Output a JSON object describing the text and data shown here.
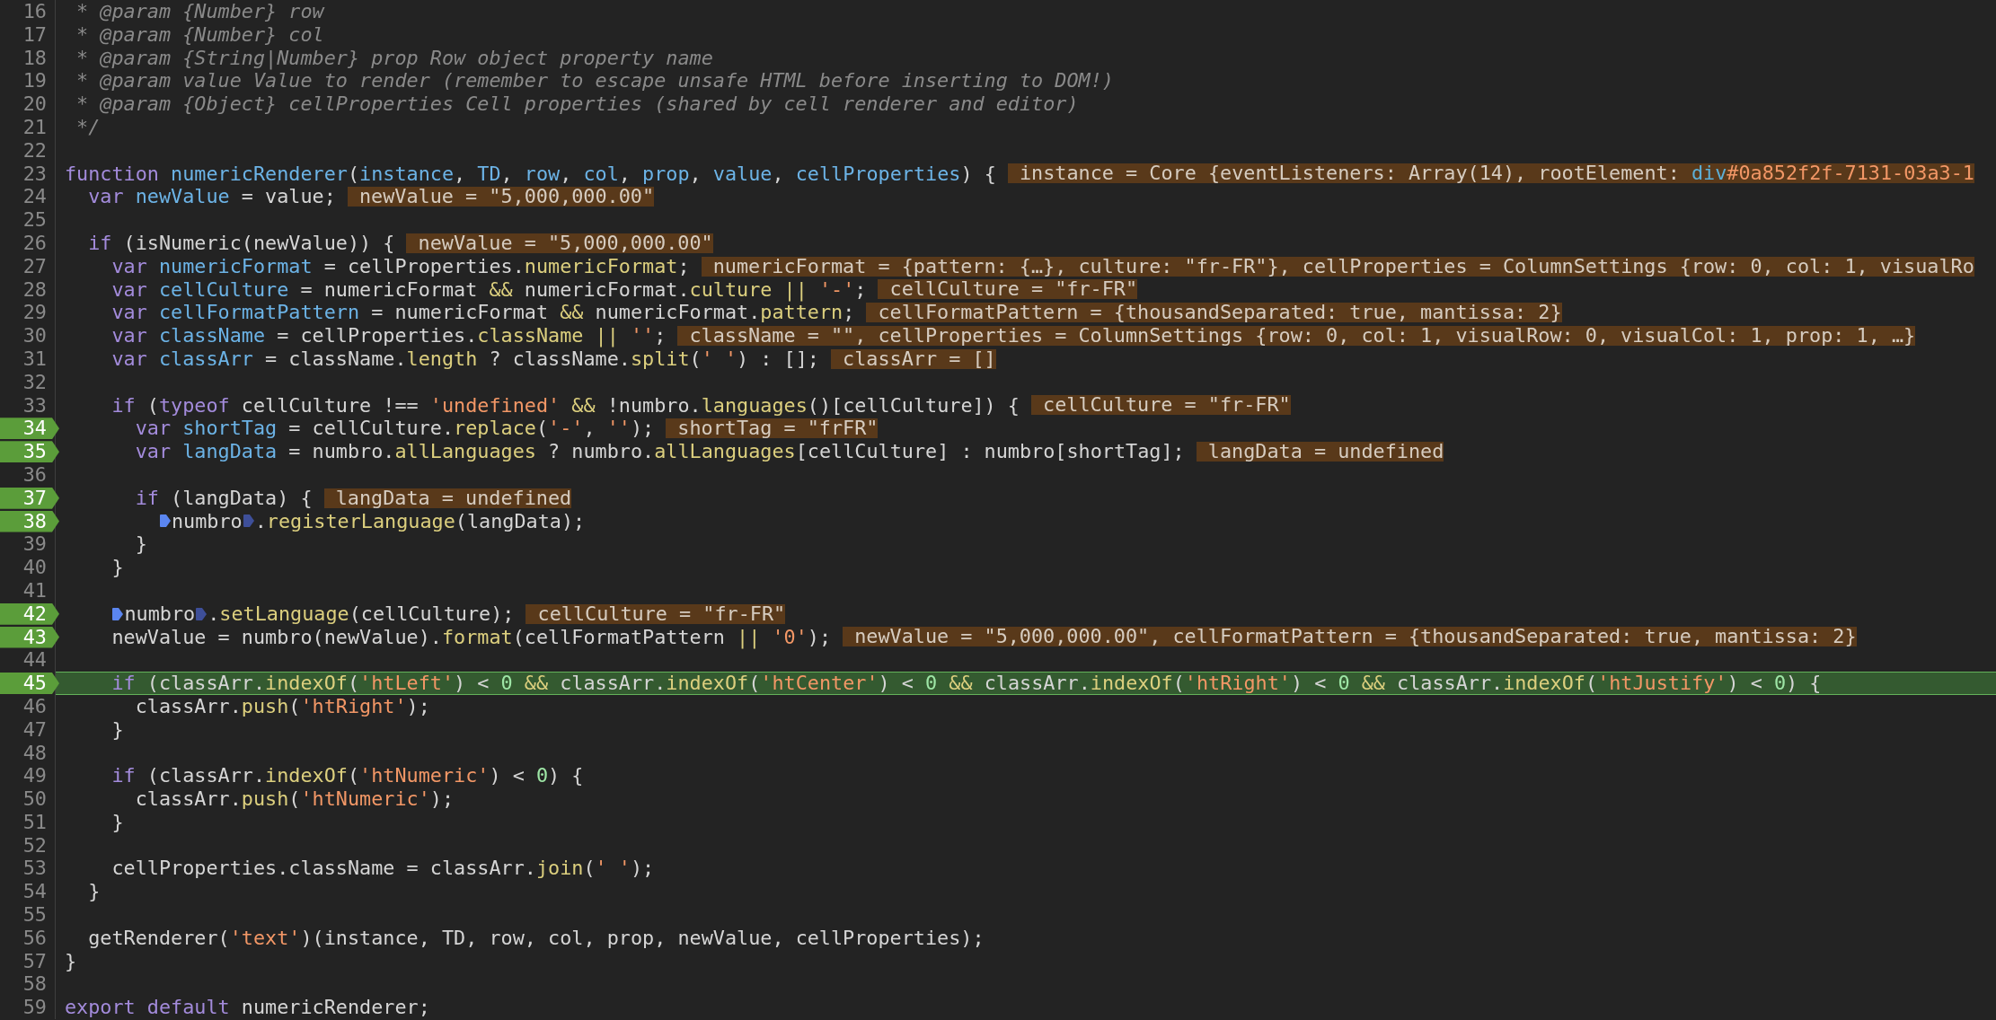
{
  "lines": [
    {
      "number": "16",
      "breakpoint": false,
      "current": false,
      "code": [
        {
          "kind": "comment",
          "text": " * @param {Number} row"
        }
      ]
    },
    {
      "number": "17",
      "breakpoint": false,
      "current": false,
      "code": [
        {
          "kind": "comment",
          "text": " * @param {Number} col"
        }
      ]
    },
    {
      "number": "18",
      "breakpoint": false,
      "current": false,
      "code": [
        {
          "kind": "comment",
          "text": " * @param {String|Number} prop Row object property name"
        }
      ]
    },
    {
      "number": "19",
      "breakpoint": false,
      "current": false,
      "code": [
        {
          "kind": "comment",
          "text": " * @param value Value to render (remember to escape unsafe HTML before inserting to DOM!)"
        }
      ]
    },
    {
      "number": "20",
      "breakpoint": false,
      "current": false,
      "code": [
        {
          "kind": "comment",
          "text": " * @param {Object} cellProperties Cell properties (shared by cell renderer and editor)"
        }
      ]
    },
    {
      "number": "21",
      "breakpoint": false,
      "current": false,
      "code": [
        {
          "kind": "comment",
          "text": " */"
        }
      ]
    },
    {
      "number": "22",
      "breakpoint": false,
      "current": false
    },
    {
      "number": "23",
      "breakpoint": false,
      "current": false,
      "code": [
        {
          "kind": "kw",
          "text": "function "
        },
        {
          "kind": "def",
          "text": "numericRenderer"
        },
        {
          "kind": "plain",
          "text": "("
        },
        {
          "kind": "def",
          "text": "instance"
        },
        {
          "kind": "plain",
          "text": ", "
        },
        {
          "kind": "def",
          "text": "TD"
        },
        {
          "kind": "plain",
          "text": ", "
        },
        {
          "kind": "def",
          "text": "row"
        },
        {
          "kind": "plain",
          "text": ", "
        },
        {
          "kind": "def",
          "text": "col"
        },
        {
          "kind": "plain",
          "text": ", "
        },
        {
          "kind": "def",
          "text": "prop"
        },
        {
          "kind": "plain",
          "text": ", "
        },
        {
          "kind": "def",
          "text": "value"
        },
        {
          "kind": "plain",
          "text": ", "
        },
        {
          "kind": "def",
          "text": "cellProperties"
        },
        {
          "kind": "plain",
          "text": ") {"
        }
      ],
      "inline_value": [
        {
          "kind": "plain",
          "text": " instance = Core {eventListeners: Array(14), rootElement: "
        },
        {
          "kind": "tag",
          "text": "div"
        },
        {
          "kind": "attr",
          "text": "#0a852f2f-7131-03a3-1"
        }
      ],
      "children": [
        {
          "number": "24",
          "breakpoint": false,
          "current": false,
          "code": [
            {
              "kind": "kw",
              "text": "var "
            },
            {
              "kind": "def",
              "text": "newValue"
            },
            {
              "kind": "plain",
              "text": " = value;"
            }
          ],
          "inline_value": [
            {
              "kind": "plain",
              "text": " newValue = \"5,000,000.00\""
            }
          ]
        },
        {
          "number": "25",
          "breakpoint": false,
          "current": false
        },
        {
          "number": "26",
          "breakpoint": false,
          "current": false,
          "code": [
            {
              "kind": "kw",
              "text": "if"
            },
            {
              "kind": "plain",
              "text": " (isNumeric(newValue)) {"
            }
          ],
          "inline_value": [
            {
              "kind": "plain",
              "text": " newValue = \"5,000,000.00\""
            }
          ],
          "children": [
            {
              "number": "27",
              "breakpoint": false,
              "current": false,
              "code": [
                {
                  "kind": "kw",
                  "text": "var "
                },
                {
                  "kind": "def",
                  "text": "numericFormat"
                },
                {
                  "kind": "plain",
                  "text": " = cellProperties."
                },
                {
                  "kind": "prop",
                  "text": "numericFormat"
                },
                {
                  "kind": "plain",
                  "text": ";"
                }
              ],
              "inline_value": [
                {
                  "kind": "plain",
                  "text": " numericFormat = {pattern: {…}, culture: \"fr-FR\"}, cellProperties = ColumnSettings {row: 0, col: 1, visualRo"
                }
              ]
            },
            {
              "number": "28",
              "breakpoint": false,
              "current": false,
              "code": [
                {
                  "kind": "kw",
                  "text": "var "
                },
                {
                  "kind": "def",
                  "text": "cellCulture"
                },
                {
                  "kind": "plain",
                  "text": " = numericFormat "
                },
                {
                  "kind": "op",
                  "text": "&&"
                },
                {
                  "kind": "plain",
                  "text": " numericFormat."
                },
                {
                  "kind": "prop",
                  "text": "culture"
                },
                {
                  "kind": "op",
                  "text": " || "
                },
                {
                  "kind": "str",
                  "text": "'-'"
                },
                {
                  "kind": "plain",
                  "text": ";"
                }
              ],
              "inline_value": [
                {
                  "kind": "plain",
                  "text": " cellCulture = \"fr-FR\""
                }
              ]
            },
            {
              "number": "29",
              "breakpoint": false,
              "current": false,
              "code": [
                {
                  "kind": "kw",
                  "text": "var "
                },
                {
                  "kind": "def",
                  "text": "cellFormatPattern"
                },
                {
                  "kind": "plain",
                  "text": " = numericFormat "
                },
                {
                  "kind": "op",
                  "text": "&&"
                },
                {
                  "kind": "plain",
                  "text": " numericFormat."
                },
                {
                  "kind": "prop",
                  "text": "pattern"
                },
                {
                  "kind": "plain",
                  "text": ";"
                }
              ],
              "inline_value": [
                {
                  "kind": "plain",
                  "text": " cellFormatPattern = {thousandSeparated: true, mantissa: 2}"
                }
              ]
            },
            {
              "number": "30",
              "breakpoint": false,
              "current": false,
              "code": [
                {
                  "kind": "kw",
                  "text": "var "
                },
                {
                  "kind": "def",
                  "text": "className"
                },
                {
                  "kind": "plain",
                  "text": " = cellProperties."
                },
                {
                  "kind": "prop",
                  "text": "className"
                },
                {
                  "kind": "op",
                  "text": " || "
                },
                {
                  "kind": "str",
                  "text": "''"
                },
                {
                  "kind": "plain",
                  "text": ";"
                }
              ],
              "inline_value": [
                {
                  "kind": "plain",
                  "text": " className = \"\", cellProperties = ColumnSettings {row: 0, col: 1, visualRow: 0, visualCol: 1, prop: 1, …}"
                }
              ]
            },
            {
              "number": "31",
              "breakpoint": false,
              "current": false,
              "code": [
                {
                  "kind": "kw",
                  "text": "var "
                },
                {
                  "kind": "def",
                  "text": "classArr"
                },
                {
                  "kind": "plain",
                  "text": " = className."
                },
                {
                  "kind": "prop",
                  "text": "length"
                },
                {
                  "kind": "plain",
                  "text": " ? className."
                },
                {
                  "kind": "prop",
                  "text": "split"
                },
                {
                  "kind": "plain",
                  "text": "("
                },
                {
                  "kind": "str",
                  "text": "' '"
                },
                {
                  "kind": "plain",
                  "text": ") : [];"
                }
              ],
              "inline_value": [
                {
                  "kind": "plain",
                  "text": " classArr = []"
                }
              ]
            },
            {
              "number": "32",
              "breakpoint": false,
              "current": false
            },
            {
              "number": "33",
              "breakpoint": false,
              "current": false,
              "code": [
                {
                  "kind": "kw",
                  "text": "if"
                },
                {
                  "kind": "plain",
                  "text": " ("
                },
                {
                  "kind": "kw",
                  "text": "typeof"
                },
                {
                  "kind": "plain",
                  "text": " cellCulture !== "
                },
                {
                  "kind": "str",
                  "text": "'undefined'"
                },
                {
                  "kind": "op",
                  "text": " && "
                },
                {
                  "kind": "plain",
                  "text": "!numbro."
                },
                {
                  "kind": "prop",
                  "text": "languages"
                },
                {
                  "kind": "plain",
                  "text": "()[cellCulture]) {"
                }
              ],
              "inline_value": [
                {
                  "kind": "plain",
                  "text": " cellCulture = \"fr-FR\""
                }
              ],
              "children": [
                {
                  "number": "34",
                  "breakpoint": true,
                  "current": false,
                  "code": [
                    {
                      "kind": "kw",
                      "text": "var "
                    },
                    {
                      "kind": "def",
                      "text": "shortTag"
                    },
                    {
                      "kind": "plain",
                      "text": " = cellCulture."
                    },
                    {
                      "kind": "prop",
                      "text": "replace"
                    },
                    {
                      "kind": "plain",
                      "text": "("
                    },
                    {
                      "kind": "str",
                      "text": "'-'"
                    },
                    {
                      "kind": "plain",
                      "text": ", "
                    },
                    {
                      "kind": "str",
                      "text": "''"
                    },
                    {
                      "kind": "plain",
                      "text": ");"
                    }
                  ],
                  "inline_value": [
                    {
                      "kind": "plain",
                      "text": " shortTag = \"frFR\""
                    }
                  ]
                },
                {
                  "number": "35",
                  "breakpoint": true,
                  "current": false,
                  "code": [
                    {
                      "kind": "kw",
                      "text": "var "
                    },
                    {
                      "kind": "def",
                      "text": "langData"
                    },
                    {
                      "kind": "plain",
                      "text": " = numbro."
                    },
                    {
                      "kind": "prop",
                      "text": "allLanguages"
                    },
                    {
                      "kind": "plain",
                      "text": " ? numbro."
                    },
                    {
                      "kind": "prop",
                      "text": "allLanguages"
                    },
                    {
                      "kind": "plain",
                      "text": "[cellCulture] : numbro[shortTag];"
                    }
                  ],
                  "inline_value": [
                    {
                      "kind": "plain",
                      "text": " langData = undefined"
                    }
                  ]
                },
                {
                  "number": "36",
                  "breakpoint": false,
                  "current": false
                },
                {
                  "number": "37",
                  "breakpoint": true,
                  "current": false,
                  "code": [
                    {
                      "kind": "kw",
                      "text": "if"
                    },
                    {
                      "kind": "plain",
                      "text": " (langData) {"
                    }
                  ],
                  "inline_value": [
                    {
                      "kind": "plain",
                      "text": " langData = undefined"
                    }
                  ],
                  "children": [
                    {
                      "number": "38",
                      "breakpoint": true,
                      "current": false,
                      "code": [
                        {
                          "kind": "marker",
                          "active": true
                        },
                        {
                          "kind": "plain",
                          "text": "numbro"
                        },
                        {
                          "kind": "marker",
                          "active": false
                        },
                        {
                          "kind": "plain",
                          "text": "."
                        },
                        {
                          "kind": "prop",
                          "text": "registerLanguage"
                        },
                        {
                          "kind": "plain",
                          "text": "(langData);"
                        }
                      ]
                    }
                  ]
                },
                {
                  "number": "39",
                  "breakpoint": false,
                  "current": false,
                  "code": [
                    {
                      "kind": "plain",
                      "text": "}"
                    }
                  ]
                }
              ]
            },
            {
              "number": "40",
              "breakpoint": false,
              "current": false,
              "code": [
                {
                  "kind": "plain",
                  "text": "}"
                }
              ]
            },
            {
              "number": "41",
              "breakpoint": false,
              "current": false
            },
            {
              "number": "42",
              "breakpoint": true,
              "current": false,
              "code": [
                {
                  "kind": "marker",
                  "active": true
                },
                {
                  "kind": "plain",
                  "text": "numbro"
                },
                {
                  "kind": "marker",
                  "active": false
                },
                {
                  "kind": "plain",
                  "text": "."
                },
                {
                  "kind": "prop",
                  "text": "setLanguage"
                },
                {
                  "kind": "plain",
                  "text": "(cellCulture);"
                }
              ],
              "inline_value": [
                {
                  "kind": "plain",
                  "text": " cellCulture = \"fr-FR\""
                }
              ]
            },
            {
              "number": "43",
              "breakpoint": true,
              "current": false,
              "code": [
                {
                  "kind": "plain",
                  "text": "newValue = numbro(newValue)."
                },
                {
                  "kind": "prop",
                  "text": "format"
                },
                {
                  "kind": "plain",
                  "text": "(cellFormatPattern "
                },
                {
                  "kind": "op",
                  "text": "|| "
                },
                {
                  "kind": "str",
                  "text": "'0'"
                },
                {
                  "kind": "plain",
                  "text": ");"
                }
              ],
              "inline_value": [
                {
                  "kind": "plain",
                  "text": " newValue = \"5,000,000.00\", cellFormatPattern = {thousandSeparated: true, mantissa: 2}"
                }
              ]
            },
            {
              "number": "44",
              "breakpoint": false,
              "current": false
            },
            {
              "number": "45",
              "breakpoint": true,
              "current": true,
              "code": [
                {
                  "kind": "kw",
                  "text": "if"
                },
                {
                  "kind": "plain",
                  "text": " (classArr."
                },
                {
                  "kind": "prop",
                  "text": "indexOf"
                },
                {
                  "kind": "plain",
                  "text": "("
                },
                {
                  "kind": "str",
                  "text": "'htLeft'"
                },
                {
                  "kind": "plain",
                  "text": ") < "
                },
                {
                  "kind": "num",
                  "text": "0"
                },
                {
                  "kind": "op",
                  "text": " && "
                },
                {
                  "kind": "plain",
                  "text": "classArr."
                },
                {
                  "kind": "prop",
                  "text": "indexOf"
                },
                {
                  "kind": "plain",
                  "text": "("
                },
                {
                  "kind": "str",
                  "text": "'htCenter'"
                },
                {
                  "kind": "plain",
                  "text": ") < "
                },
                {
                  "kind": "num",
                  "text": "0"
                },
                {
                  "kind": "op",
                  "text": " && "
                },
                {
                  "kind": "plain",
                  "text": "classArr."
                },
                {
                  "kind": "prop",
                  "text": "indexOf"
                },
                {
                  "kind": "plain",
                  "text": "("
                },
                {
                  "kind": "str",
                  "text": "'htRight'"
                },
                {
                  "kind": "plain",
                  "text": ") < "
                },
                {
                  "kind": "num",
                  "text": "0"
                },
                {
                  "kind": "op",
                  "text": " && "
                },
                {
                  "kind": "plain",
                  "text": "classArr."
                },
                {
                  "kind": "prop",
                  "text": "indexOf"
                },
                {
                  "kind": "plain",
                  "text": "("
                },
                {
                  "kind": "str",
                  "text": "'htJustify'"
                },
                {
                  "kind": "plain",
                  "text": ") < "
                },
                {
                  "kind": "num",
                  "text": "0"
                },
                {
                  "kind": "plain",
                  "text": ") {"
                }
              ],
              "children": [
                {
                  "number": "46",
                  "breakpoint": false,
                  "current": false,
                  "code": [
                    {
                      "kind": "plain",
                      "text": "classArr."
                    },
                    {
                      "kind": "prop",
                      "text": "push"
                    },
                    {
                      "kind": "plain",
                      "text": "("
                    },
                    {
                      "kind": "str",
                      "text": "'htRight'"
                    },
                    {
                      "kind": "plain",
                      "text": ");"
                    }
                  ]
                }
              ]
            },
            {
              "number": "47",
              "breakpoint": false,
              "current": false,
              "code": [
                {
                  "kind": "plain",
                  "text": "}"
                }
              ]
            },
            {
              "number": "48",
              "breakpoint": false,
              "current": false
            },
            {
              "number": "49",
              "breakpoint": false,
              "current": false,
              "code": [
                {
                  "kind": "kw",
                  "text": "if"
                },
                {
                  "kind": "plain",
                  "text": " (classArr."
                },
                {
                  "kind": "prop",
                  "text": "indexOf"
                },
                {
                  "kind": "plain",
                  "text": "("
                },
                {
                  "kind": "str",
                  "text": "'htNumeric'"
                },
                {
                  "kind": "plain",
                  "text": ") < "
                },
                {
                  "kind": "num",
                  "text": "0"
                },
                {
                  "kind": "plain",
                  "text": ") {"
                }
              ],
              "children": [
                {
                  "number": "50",
                  "breakpoint": false,
                  "current": false,
                  "code": [
                    {
                      "kind": "plain",
                      "text": "classArr."
                    },
                    {
                      "kind": "prop",
                      "text": "push"
                    },
                    {
                      "kind": "plain",
                      "text": "("
                    },
                    {
                      "kind": "str",
                      "text": "'htNumeric'"
                    },
                    {
                      "kind": "plain",
                      "text": ");"
                    }
                  ]
                }
              ]
            },
            {
              "number": "51",
              "breakpoint": false,
              "current": false,
              "code": [
                {
                  "kind": "plain",
                  "text": "}"
                }
              ]
            },
            {
              "number": "52",
              "breakpoint": false,
              "current": false
            },
            {
              "number": "53",
              "breakpoint": false,
              "current": false,
              "code": [
                {
                  "kind": "plain",
                  "text": "cellProperties.className = classArr."
                },
                {
                  "kind": "prop",
                  "text": "join"
                },
                {
                  "kind": "plain",
                  "text": "("
                },
                {
                  "kind": "str",
                  "text": "' '"
                },
                {
                  "kind": "plain",
                  "text": ");"
                }
              ]
            }
          ]
        },
        {
          "number": "54",
          "breakpoint": false,
          "current": false,
          "code": [
            {
              "kind": "plain",
              "text": "}"
            }
          ]
        },
        {
          "number": "55",
          "breakpoint": false,
          "current": false
        },
        {
          "number": "56",
          "breakpoint": false,
          "current": false,
          "code": [
            {
              "kind": "plain",
              "text": "getRenderer("
            },
            {
              "kind": "str",
              "text": "'text'"
            },
            {
              "kind": "plain",
              "text": ")(instance, TD, row, col, prop, newValue, cellProperties);"
            }
          ]
        }
      ]
    },
    {
      "number": "57",
      "breakpoint": false,
      "current": false,
      "code": [
        {
          "kind": "plain",
          "text": "}"
        }
      ]
    },
    {
      "number": "58",
      "breakpoint": false,
      "current": false
    },
    {
      "number": "59",
      "breakpoint": false,
      "current": false,
      "code": [
        {
          "kind": "kw",
          "text": "export default"
        },
        {
          "kind": "plain",
          "text": " numericRenderer;"
        }
      ]
    }
  ]
}
